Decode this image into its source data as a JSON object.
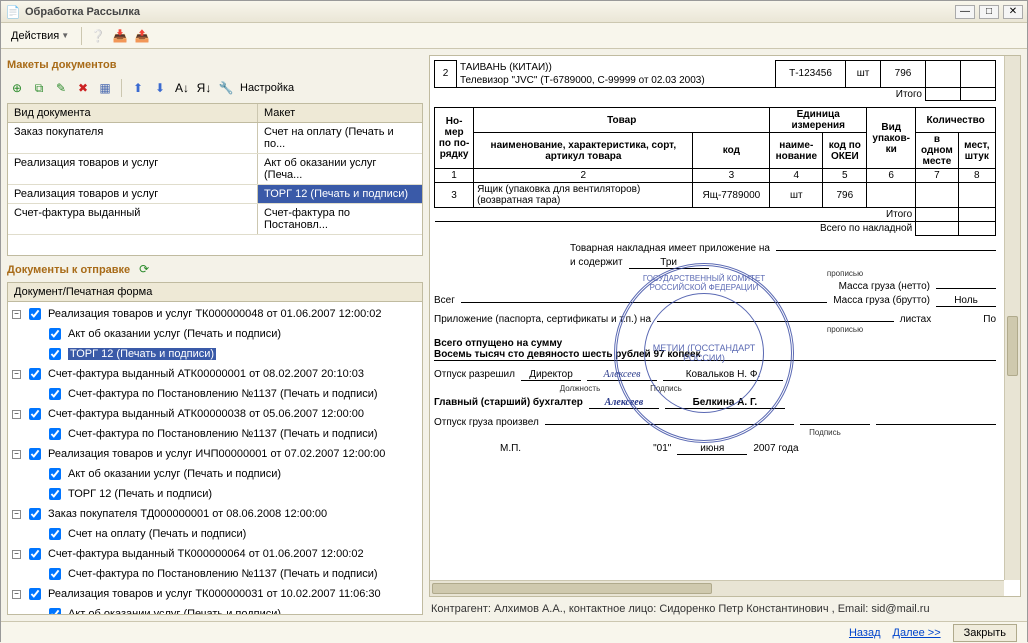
{
  "window": {
    "title": "Обработка  Рассылка"
  },
  "toolbar": {
    "actions": "Действия",
    "settings": "Настройка"
  },
  "sections": {
    "templates": "Макеты документов",
    "tosend": "Документы к отправке"
  },
  "templates_table": {
    "headers": {
      "type": "Вид документа",
      "layout": "Макет"
    },
    "rows": [
      {
        "type": "Заказ покупателя",
        "layout": "Счет на оплату (Печать и по...",
        "selected": false
      },
      {
        "type": "Реализация товаров и услуг",
        "layout": "Акт об оказании услуг (Печа...",
        "selected": false
      },
      {
        "type": "Реализация товаров и услуг",
        "layout": "ТОРГ 12 (Печать и подписи)",
        "selected": true
      },
      {
        "type": "Счет-фактура выданный",
        "layout": "Счет-фактура по Постановл...",
        "selected": false
      }
    ]
  },
  "tree": {
    "header": "Документ/Печатная форма",
    "nodes": [
      {
        "label": "Реализация товаров и услуг ТК000000048 от 01.06.2007 12:00:02",
        "children": [
          {
            "label": "Акт об оказании услуг (Печать и подписи)"
          },
          {
            "label": "ТОРГ 12 (Печать и подписи)",
            "selected": true
          }
        ]
      },
      {
        "label": "Счет-фактура выданный АТК00000001 от 08.02.2007 20:10:03",
        "children": [
          {
            "label": "Счет-фактура по Постановлению №1137 (Печать и подписи)"
          }
        ]
      },
      {
        "label": "Счет-фактура выданный АТК00000038 от 05.06.2007 12:00:00",
        "children": [
          {
            "label": "Счет-фактура по Постановлению №1137 (Печать и подписи)"
          }
        ]
      },
      {
        "label": "Реализация товаров и услуг ИЧП00000001 от 07.02.2007 12:00:00",
        "children": [
          {
            "label": "Акт об оказании услуг (Печать и подписи)"
          },
          {
            "label": "ТОРГ 12 (Печать и подписи)"
          }
        ]
      },
      {
        "label": "Заказ покупателя ТД000000001 от 08.06.2008 12:00:00",
        "children": [
          {
            "label": "Счет на оплату (Печать и подписи)"
          }
        ]
      },
      {
        "label": "Счет-фактура выданный ТК000000064 от 01.06.2007 12:00:02",
        "children": [
          {
            "label": "Счет-фактура по Постановлению №1137 (Печать и подписи)"
          }
        ]
      },
      {
        "label": "Реализация товаров и услуг ТК000000031 от 10.02.2007 11:06:30",
        "children": [
          {
            "label": "Акт об оказании услуг (Печать и подписи)"
          }
        ]
      }
    ]
  },
  "doc": {
    "row_top": {
      "n": "2",
      "name": "Телевизор \"JVC\" (Т-6789000, С-99999 от 02.03 2003)",
      "name_above": "ТАИВАНЬ (КИТАИ))",
      "code": "Т-123456",
      "unit": "шт",
      "okei": "796"
    },
    "itogo": "Итого",
    "headers": {
      "nomer": "Но-\nмер\nпо по-\nрядку",
      "tovar": "Товар",
      "naimen_full": "наименование, характеристика, сорт, артикул товара",
      "kod": "код",
      "edizm": "Единица измерения",
      "edizm_naimen": "наиме-\nнование",
      "edizm_okei": "код по ОКЕИ",
      "vid_upak": "Вид упаков-\nки",
      "kolvo": "Количество",
      "v_odnom": "в одном месте",
      "mest": "мест, штук"
    },
    "nums": {
      "c1": "1",
      "c2": "2",
      "c3": "3",
      "c4": "4",
      "c5": "5",
      "c6": "6",
      "c7": "7",
      "c8": "8"
    },
    "row3": {
      "n": "3",
      "name": "Ящик (упаковка для вентиляторов) (возвратная тара)",
      "code": "Ящ-7789000",
      "unit": "шт",
      "okei": "796"
    },
    "footer1": "Итого",
    "footer2": "Всего по накладной",
    "lines": {
      "has_attach": "Товарная накладная имеет приложение на",
      "contains": "и содержит",
      "contains_val": "Три",
      "propis": "прописью",
      "mass_netto": "Масса груза (нетто)",
      "vsego": "Всег",
      "mass_brutto": "Масса груза (брутто)",
      "nol": "Ноль",
      "attach": "Приложение (паспорта, сертификаты и т.п.) на",
      "listah": "листах",
      "po": "По",
      "total": "Всего отпущено на сумму",
      "total_words": "Восемь тысяч сто девяносто шесть рублей 97 копеек",
      "release": "Отпуск разрешил",
      "director": "Директор",
      "dolzh": "Должность",
      "podpis": "Подпись",
      "name1": "Ковальков  Н. Ф.",
      "chief": "Главный (старший) бухгалтер",
      "name2": "Белкина А. Г.",
      "released": "Отпуск груза произвел",
      "mp": "М.П.",
      "date_d": "\"01\"",
      "date_m": "июня",
      "date_y": "2007 года"
    },
    "stamp_outer": "ГОСУДАРСТВЕННЫЙ КОМИТЕТ РОССИЙСКОЙ ФЕДЕРАЦИИ",
    "stamp_inner": "МЕТИИ (ГОССТАНДАРТ РОССИИ)"
  },
  "footer_info": "Контрагент: Алхимов А.А., контактное лицо: Сидоренко Петр Константинович , Email: sid@mail.ru",
  "buttons": {
    "back": "Назад",
    "next": "Далее >>",
    "close": "Закрыть"
  }
}
